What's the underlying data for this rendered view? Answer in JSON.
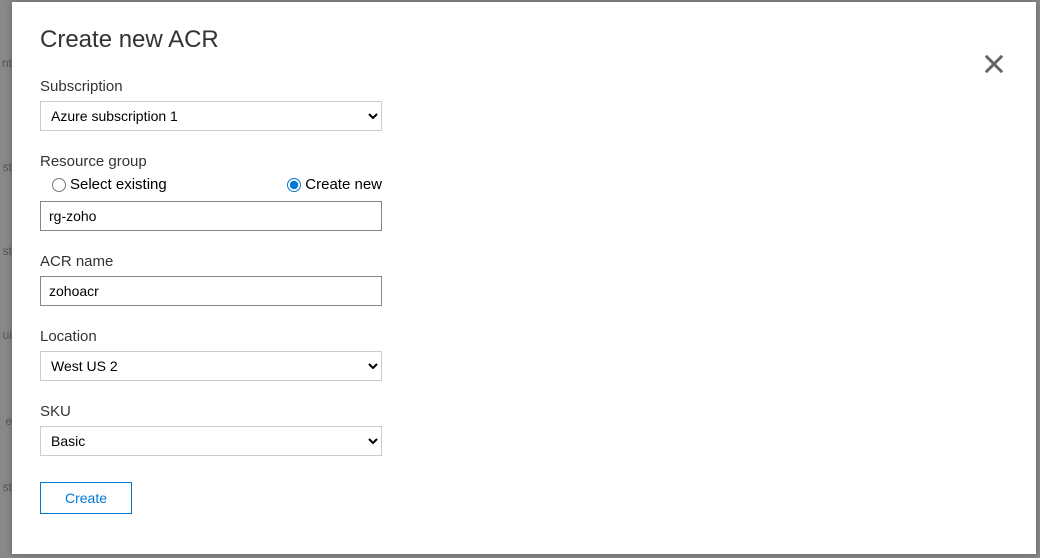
{
  "modal": {
    "title": "Create new ACR",
    "close_label": "Close"
  },
  "subscription": {
    "label": "Subscription",
    "value": "Azure subscription 1"
  },
  "resourceGroup": {
    "label": "Resource group",
    "options": {
      "selectExisting": "Select existing",
      "createNew": "Create new",
      "selected": "createNew"
    },
    "value": "rg-zoho"
  },
  "acrName": {
    "label": "ACR name",
    "value": "zohoacr"
  },
  "location": {
    "label": "Location",
    "value": "West US 2"
  },
  "sku": {
    "label": "SKU",
    "value": "Basic"
  },
  "actions": {
    "create": "Create"
  },
  "background_fragments": [
    "nt",
    "st",
    "st",
    "ui",
    "e",
    "st"
  ]
}
